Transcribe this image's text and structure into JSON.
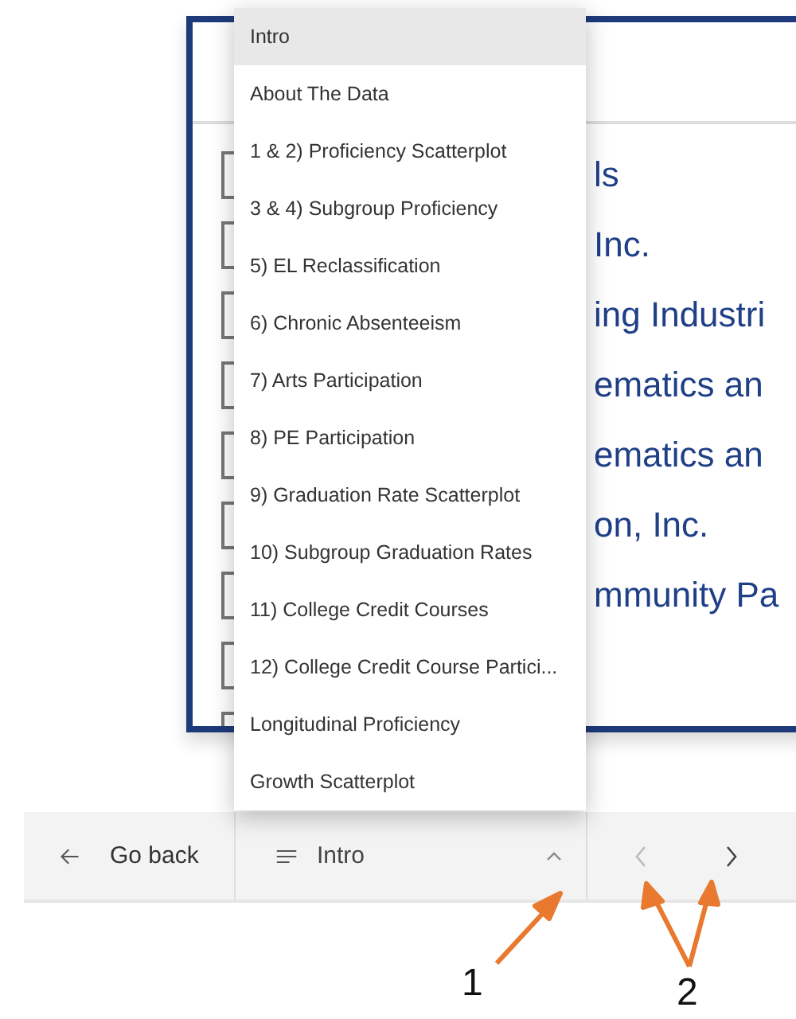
{
  "report": {
    "rows": [
      {
        "text": "ls",
        "checked": false
      },
      {
        "text": "Inc.",
        "checked": false
      },
      {
        "text": "ing Industri",
        "checked": false
      },
      {
        "text": "ematics an",
        "checked": false
      },
      {
        "text": "ematics an",
        "checked": false
      },
      {
        "text": "on, Inc.",
        "checked": false
      },
      {
        "text": "mmunity Pa",
        "checked": false
      },
      {
        "checked": false
      },
      {
        "checked": false
      }
    ]
  },
  "page_menu": {
    "items": [
      {
        "label": "Intro",
        "selected": true
      },
      {
        "label": "About The Data",
        "selected": false
      },
      {
        "label": "1 & 2) Proficiency Scatterplot",
        "selected": false
      },
      {
        "label": "3 & 4) Subgroup Proficiency",
        "selected": false
      },
      {
        "label": "5) EL Reclassification",
        "selected": false
      },
      {
        "label": "6) Chronic Absenteeism",
        "selected": false
      },
      {
        "label": "7) Arts Participation",
        "selected": false
      },
      {
        "label": "8) PE Participation",
        "selected": false
      },
      {
        "label": "9) Graduation Rate Scatterplot",
        "selected": false
      },
      {
        "label": "10) Subgroup Graduation Rates",
        "selected": false
      },
      {
        "label": "11) College Credit Courses",
        "selected": false
      },
      {
        "label": "12) College Credit Course Partici...",
        "selected": false
      },
      {
        "label": "Longitudinal Proficiency",
        "selected": false
      },
      {
        "label": "Growth Scatterplot",
        "selected": false
      }
    ]
  },
  "bottom_bar": {
    "back": "Go back",
    "current_page": "Intro",
    "menu_expanded": true,
    "previous_disabled": true,
    "next_disabled": false
  },
  "annotations": [
    {
      "label": "1"
    },
    {
      "label": "2"
    }
  ]
}
